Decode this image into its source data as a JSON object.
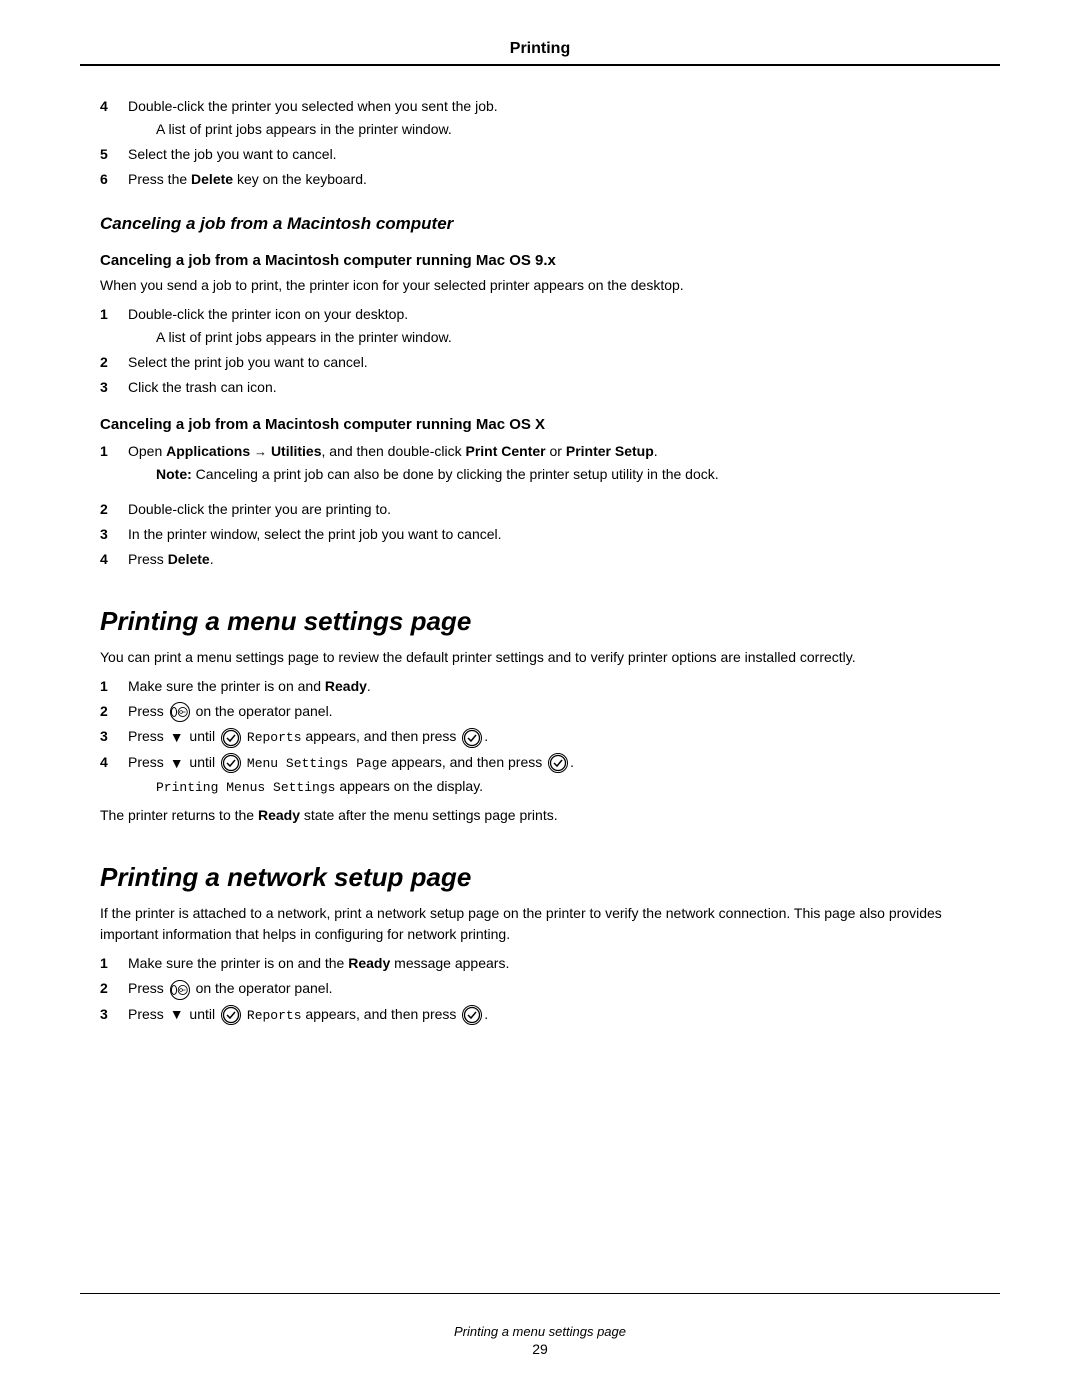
{
  "header": {
    "title": "Printing",
    "rule": true
  },
  "intro_steps": {
    "step4": {
      "num": "4",
      "text": "Double-click the printer you selected when you sent the job.",
      "sub": "A list of print jobs appears in the printer window."
    },
    "step5": {
      "num": "5",
      "text": "Select the job you want to cancel."
    },
    "step6": {
      "num": "6",
      "text_prefix": "Press the ",
      "bold": "Delete",
      "text_suffix": " key on the keyboard."
    }
  },
  "section_canceling": {
    "heading": "Canceling a job from a Macintosh computer",
    "subsection1": {
      "heading": "Canceling a job from a Macintosh computer running Mac OS 9.x",
      "intro": "When you send a job to print, the printer icon for your selected printer appears on the desktop.",
      "steps": [
        {
          "num": "1",
          "text": "Double-click the printer icon on your desktop.",
          "sub": "A list of print jobs appears in the printer window."
        },
        {
          "num": "2",
          "text": "Select the print job you want to cancel."
        },
        {
          "num": "3",
          "text": "Click the trash can icon."
        }
      ]
    },
    "subsection2": {
      "heading": "Canceling a job from a Macintosh computer running Mac OS X",
      "steps": [
        {
          "num": "1",
          "text_prefix": "Open ",
          "bold1": "Applications",
          "arrow": "→",
          "bold2": "Utilities",
          "text_mid": ", and then double-click ",
          "bold3": "Print Center",
          "text_or": " or ",
          "bold4": "Printer Setup",
          "text_suffix": ".",
          "note": "Note: Canceling a print job can also be done by clicking the printer setup utility in the dock."
        },
        {
          "num": "2",
          "text": "Double-click the printer you are printing to."
        },
        {
          "num": "3",
          "text": "In the printer window, select the print job you want to cancel."
        },
        {
          "num": "4",
          "text_prefix": "Press ",
          "bold": "Delete",
          "text_suffix": "."
        }
      ]
    }
  },
  "section_menu_settings": {
    "heading": "Printing a menu settings page",
    "intro": "You can print a menu settings page to review the default printer settings and to verify printer options are installed correctly.",
    "steps": [
      {
        "num": "1",
        "text_prefix": "Make sure the printer is on and ",
        "bold": "Ready",
        "text_suffix": "."
      },
      {
        "num": "2",
        "text_prefix": "Press",
        "icon": "menu",
        "text_suffix": "on the operator panel."
      },
      {
        "num": "3",
        "text_prefix": "Press",
        "icon": "down",
        "text_mid": "until",
        "icon2": "check",
        "mono": "Reports",
        "text_suffix": "appears, and then press",
        "icon3": "check"
      },
      {
        "num": "4",
        "text_prefix": "Press",
        "icon": "down",
        "text_mid": "until",
        "icon2": "check",
        "mono": "Menu Settings Page",
        "text_suffix": "appears, and then press",
        "icon3": "check"
      }
    ],
    "after_steps_mono": "Printing Menus Settings",
    "after_steps_suffix": "appears on the display.",
    "closing": "The printer returns to the Ready state after the menu settings page prints."
  },
  "section_network_setup": {
    "heading": "Printing a network setup page",
    "intro": "If the printer is attached to a network, print a network setup page on the printer to verify the network connection. This page also provides important information that helps in configuring for network printing.",
    "steps": [
      {
        "num": "1",
        "text_prefix": "Make sure the printer is on and the ",
        "bold": "Ready",
        "text_suffix": " message appears."
      },
      {
        "num": "2",
        "text_prefix": "Press",
        "icon": "menu",
        "text_suffix": "on the operator panel."
      },
      {
        "num": "3",
        "text_prefix": "Press",
        "icon": "down",
        "text_mid": "until",
        "icon2": "check",
        "mono": "Reports",
        "text_suffix": "appears, and then press",
        "icon3": "check"
      }
    ]
  },
  "footer": {
    "label": "Printing a menu settings page",
    "page_number": "29"
  }
}
